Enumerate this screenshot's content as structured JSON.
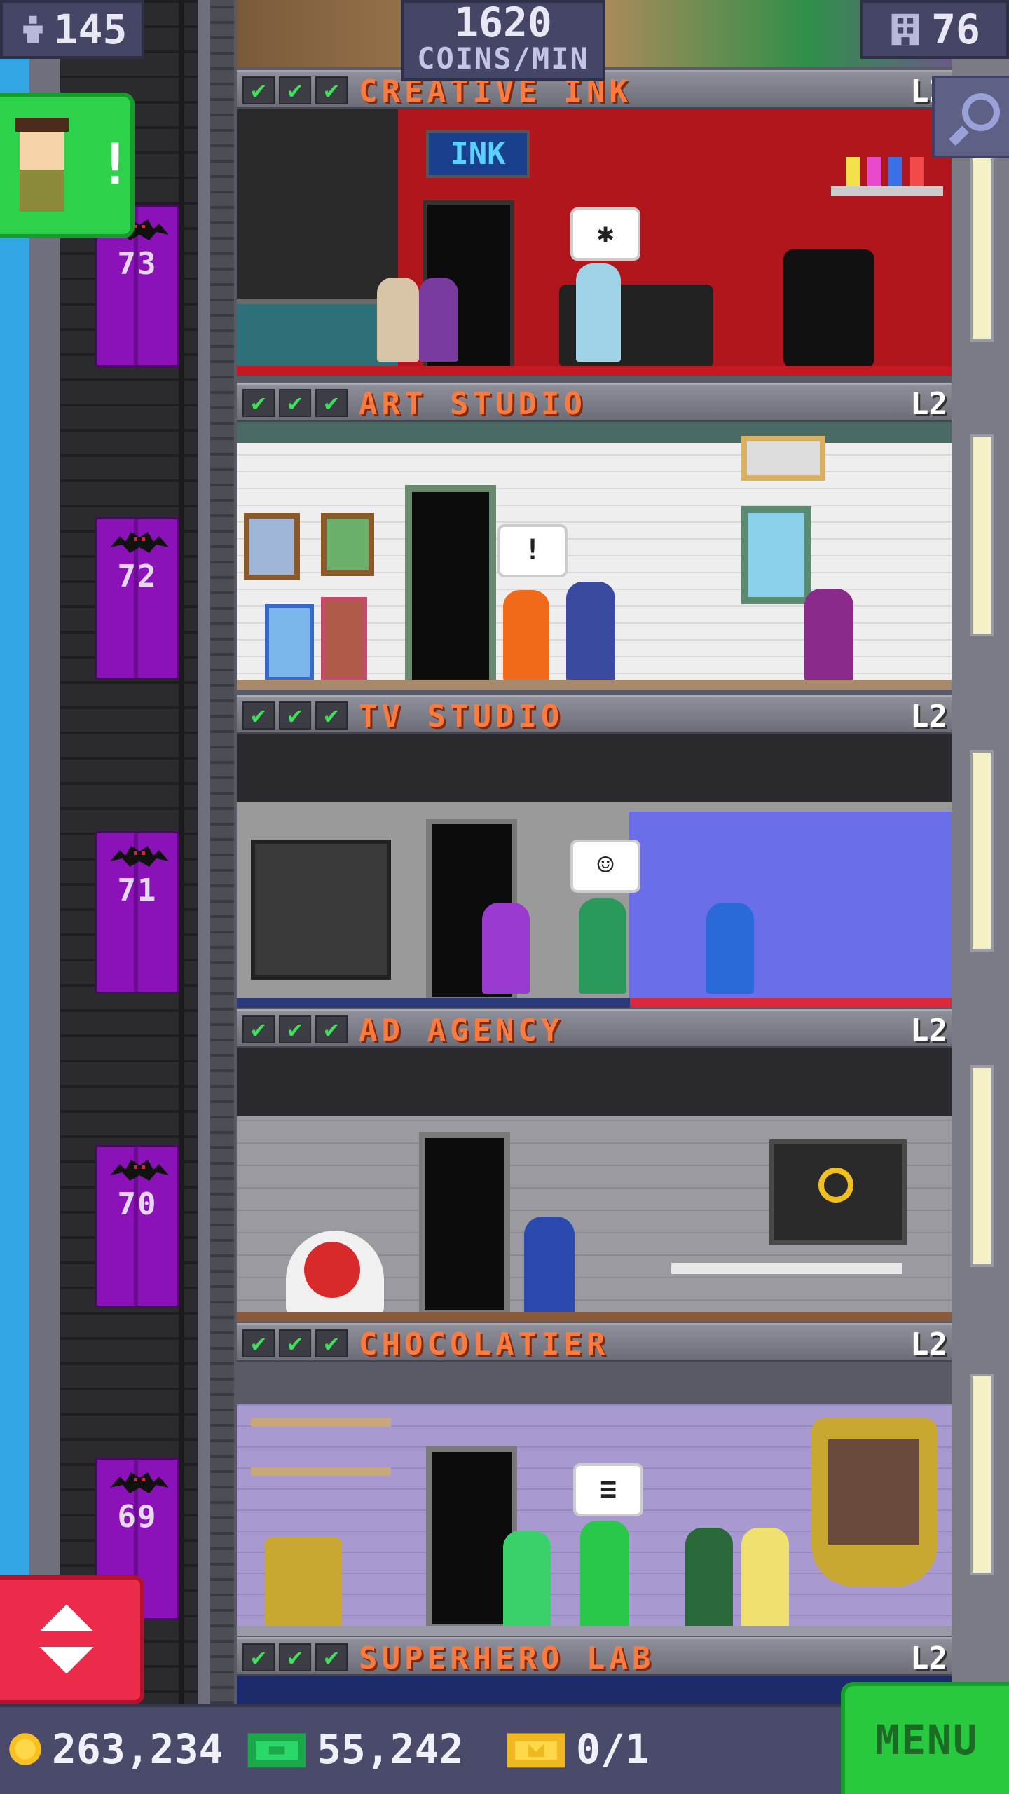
{
  "hud": {
    "population": "145",
    "coins_per_min": "1620",
    "coins_per_min_label": "COINS/MIN",
    "floor_count": "76"
  },
  "floors": [
    {
      "name": "CREATIVE INK",
      "level": "L2",
      "elevator_floor": "73",
      "checks": [
        "✔",
        "✔",
        "✔"
      ]
    },
    {
      "name": "ART STUDIO",
      "level": "L2",
      "elevator_floor": "72",
      "checks": [
        "✔",
        "✔",
        "✔"
      ]
    },
    {
      "name": "TV STUDIO",
      "level": "L2",
      "elevator_floor": "71",
      "checks": [
        "✔",
        "✔",
        "✔"
      ]
    },
    {
      "name": "AD AGENCY",
      "level": "L2",
      "elevator_floor": "70",
      "checks": [
        "✔",
        "✔",
        "✔"
      ]
    },
    {
      "name": "CHOCOLATIER",
      "level": "L2",
      "elevator_floor": "69",
      "checks": [
        "✔",
        "✔",
        "✔"
      ]
    },
    {
      "name": "SUPERHERO LAB",
      "level": "L2",
      "checks": [
        "✔",
        "✔",
        "✔"
      ]
    }
  ],
  "room_text": {
    "ink_sign": "INK",
    "bubble_art": "!"
  },
  "bottom": {
    "coins": "263,234",
    "bux": "55,242",
    "tickets": "0/1",
    "menu_label": "MENU"
  },
  "visitor_alert": "!",
  "icons": {
    "population": "person-up-icon",
    "floors": "building-icon",
    "zoom": "magnifier-icon",
    "elevator": "up-down-arrows-icon",
    "coins": "coin-icon",
    "bux": "tower-bux-icon",
    "tickets": "golden-ticket-icon"
  },
  "colors": {
    "elevator": "#8b12b8",
    "floor_name": "#ff7a3d",
    "check": "#3fe05a",
    "menu": "#29c93f",
    "elevator_button": "#ec2b4a"
  }
}
